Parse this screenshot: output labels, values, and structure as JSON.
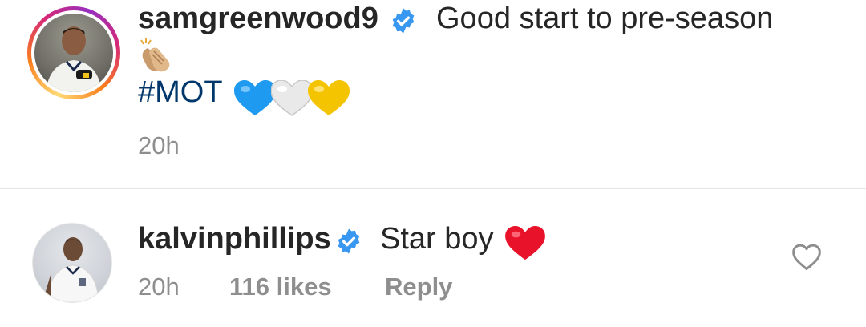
{
  "caption": {
    "username": "samgreenwood9",
    "text": "Good start to pre-season",
    "hashtag": "#MOT",
    "timestamp": "20h"
  },
  "comment": {
    "username": "kalvinphillips",
    "text": "Star boy",
    "timestamp": "20h",
    "likes": "116 likes",
    "reply_label": "Reply"
  },
  "icons": {
    "verified": "verified-badge-icon",
    "clap": "clapping-hands-emoji",
    "blue_heart": "blue-heart-emoji",
    "white_heart": "white-heart-emoji",
    "yellow_heart": "yellow-heart-emoji",
    "red_heart": "red-heart-emoji",
    "like": "heart-outline-icon"
  },
  "colors": {
    "verified": "#3897f0",
    "hashtag": "#00376b",
    "meta": "#8e8e8e",
    "story_ring": [
      "#feda75",
      "#fa7e1e",
      "#d62976",
      "#962fbf"
    ]
  }
}
